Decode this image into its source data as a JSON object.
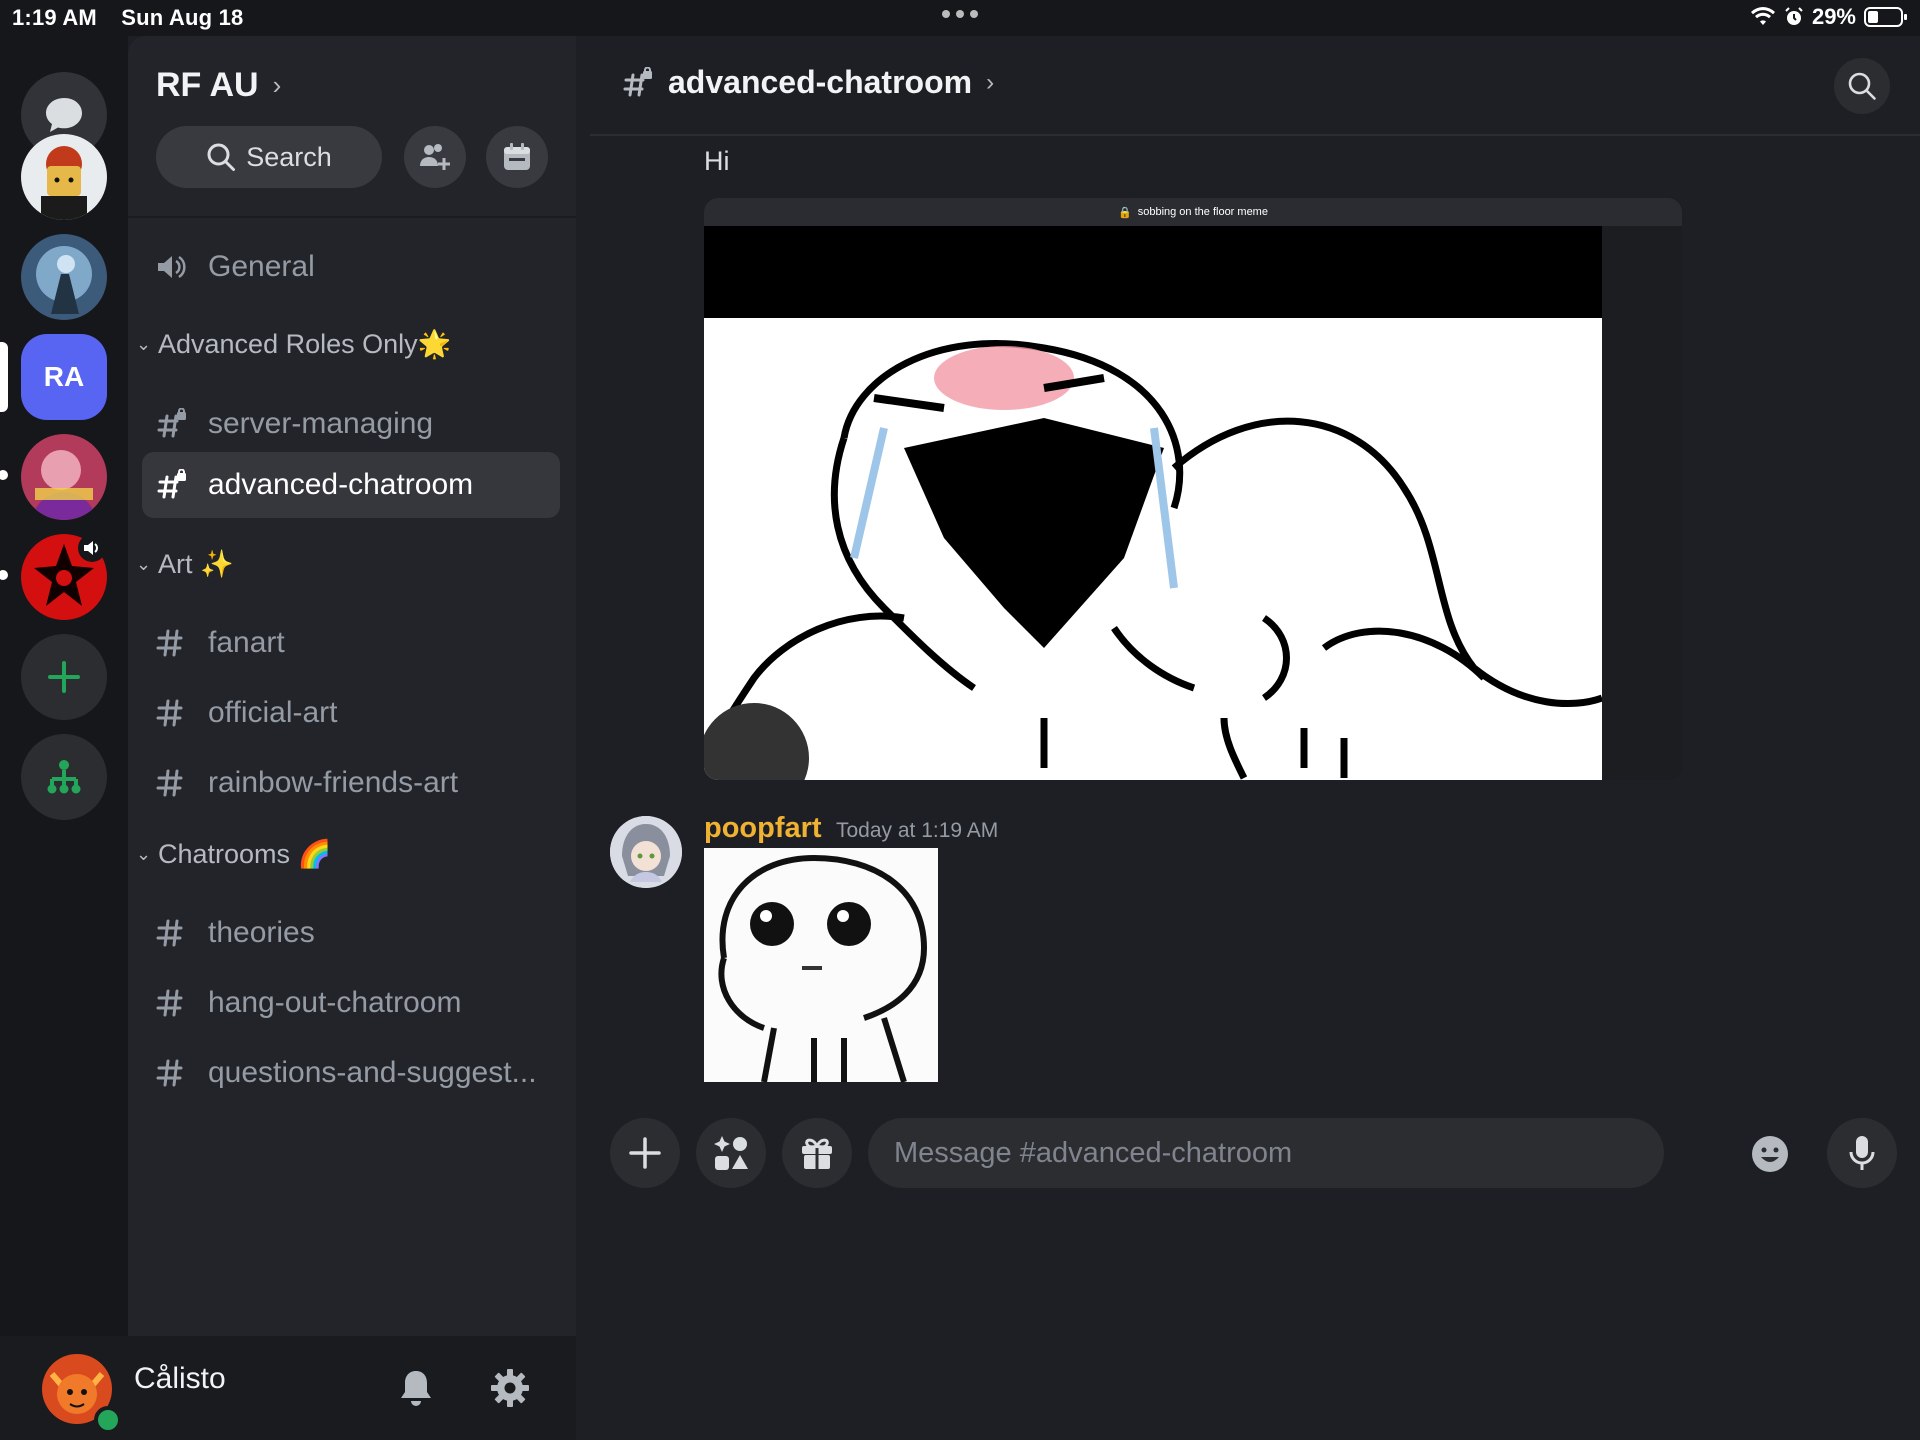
{
  "status_bar": {
    "time": "1:19 AM",
    "date": "Sun Aug 18",
    "battery": "29%"
  },
  "server_rail": {
    "servers": [
      {
        "name": "direct-messages"
      },
      {
        "name": "server-avatar-1"
      },
      {
        "name": "server-avatar-2"
      },
      {
        "name": "RA",
        "initials": "RA",
        "active": true
      },
      {
        "name": "server-avatar-4"
      },
      {
        "name": "server-avatar-5"
      }
    ]
  },
  "sidebar": {
    "server_name": "RF AU",
    "search_label": "Search",
    "general": "General",
    "categories": {
      "advanced": "Advanced Roles Only🌟",
      "art": "Art ✨",
      "chatrooms": "Chatrooms 🌈"
    },
    "channels": {
      "server_managing": "server-managing",
      "advanced_chatroom": "advanced-chatroom",
      "fanart": "fanart",
      "official_art": "official-art",
      "rainbow_friends_art": "rainbow-friends-art",
      "theories": "theories",
      "hang_out_chatroom": "hang-out-chatroom",
      "questions": "questions-and-suggest..."
    }
  },
  "user_panel": {
    "username": "Cålisto"
  },
  "main": {
    "channel_title": "advanced-chatroom",
    "first_message": "Hi",
    "attachment1_caption": "sobbing on the floor meme",
    "message": {
      "author": "poopfart",
      "timestamp": "Today at 1:19 AM"
    },
    "composer_placeholder": "Message #advanced-chatroom"
  },
  "colors": {
    "accent": "#5865f2",
    "online": "#23a55a",
    "author": "#f0b232",
    "add_server": "#23a55a"
  }
}
